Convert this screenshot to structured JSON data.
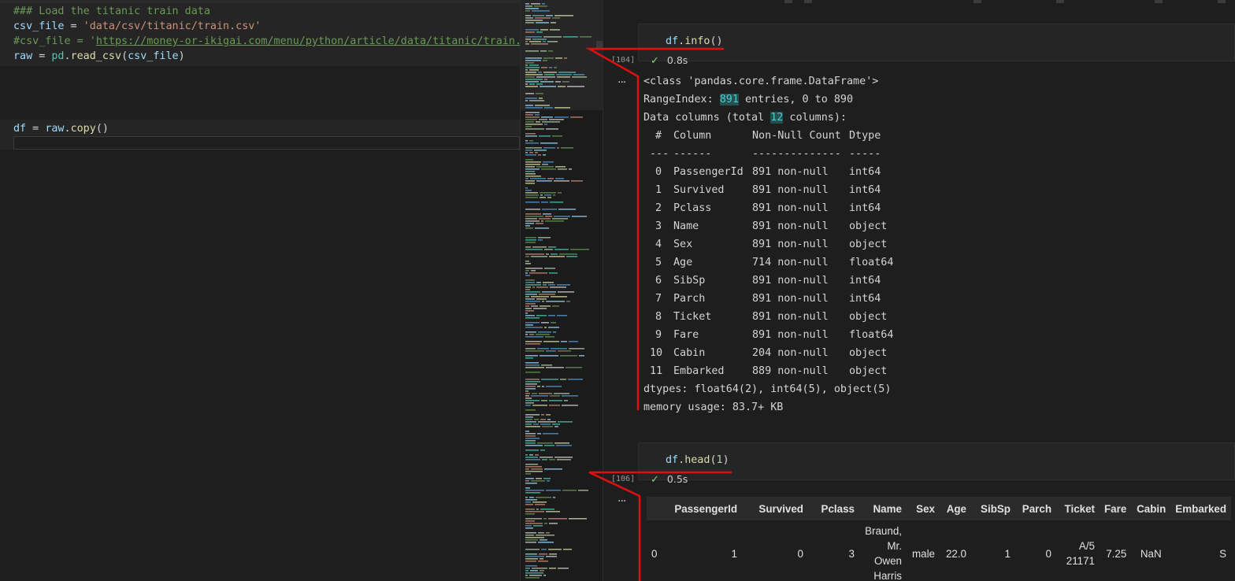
{
  "editor": {
    "block1": {
      "line1": "### Load the titanic train data",
      "line2": {
        "var": "csv_file",
        "op": " = ",
        "str": "'data/csv/titanic/train.csv'"
      },
      "line3": {
        "comment_prefix": "#csv_file = '",
        "url": "https://money-or-ikigai.com/menu/python/article/data/titanic/train.csv"
      },
      "line4": {
        "var": "raw",
        "op": " = ",
        "mod": "pd",
        "fn": "read_csv",
        "arg": "csv_file"
      }
    },
    "block2": {
      "line1": {
        "var": "df",
        "op": " = ",
        "obj": "raw",
        "fn": "copy"
      }
    }
  },
  "cells": [
    {
      "code": {
        "obj": "df",
        "fn": "info",
        "args": ""
      },
      "exec_count": "[104]",
      "status": "0.8s",
      "output": {
        "class_line": "<class 'pandas.core.frame.DataFrame'>",
        "range_prefix": "RangeIndex: ",
        "range_num": "891",
        "range_suffix": " entries, 0 to 890",
        "cols_prefix": "Data columns (total ",
        "cols_num": "12",
        "cols_suffix": " columns):",
        "header": [
          "#",
          "Column",
          "Non-Null Count",
          "Dtype"
        ],
        "sep": [
          "---",
          "------",
          "--------------",
          "-----"
        ],
        "rows": [
          [
            "0",
            "PassengerId",
            "891 non-null",
            "int64"
          ],
          [
            "1",
            "Survived",
            "891 non-null",
            "int64"
          ],
          [
            "2",
            "Pclass",
            "891 non-null",
            "int64"
          ],
          [
            "3",
            "Name",
            "891 non-null",
            "object"
          ],
          [
            "4",
            "Sex",
            "891 non-null",
            "object"
          ],
          [
            "5",
            "Age",
            "714 non-null",
            "float64"
          ],
          [
            "6",
            "SibSp",
            "891 non-null",
            "int64"
          ],
          [
            "7",
            "Parch",
            "891 non-null",
            "int64"
          ],
          [
            "8",
            "Ticket",
            "891 non-null",
            "object"
          ],
          [
            "9",
            "Fare",
            "891 non-null",
            "float64"
          ],
          [
            "10",
            "Cabin",
            "204 non-null",
            "object"
          ],
          [
            "11",
            "Embarked",
            "889 non-null",
            "object"
          ]
        ],
        "dtypes": "dtypes: float64(2), int64(5), object(5)",
        "memory": "memory usage: 83.7+ KB"
      }
    },
    {
      "code": {
        "obj": "df",
        "fn": "head",
        "args": "1"
      },
      "exec_count": "[106]",
      "status": "0.5s",
      "table": {
        "columns": [
          "",
          "PassengerId",
          "Survived",
          "Pclass",
          "Name",
          "Sex",
          "Age",
          "SibSp",
          "Parch",
          "Ticket",
          "Fare",
          "Cabin",
          "Embarked"
        ],
        "row": {
          "index": "0",
          "PassengerId": "1",
          "Survived": "0",
          "Pclass": "3",
          "Name_lines": [
            "Braund,",
            "Mr.",
            "Owen",
            "Harris"
          ],
          "Sex": "male",
          "Age": "22.0",
          "SibSp": "1",
          "Parch": "0",
          "Ticket_lines": [
            "A/5",
            "21171"
          ],
          "Fare": "7.25",
          "Cabin": "NaN",
          "Embarked": "S"
        }
      }
    }
  ],
  "ellipsis": "...",
  "check_icon": "check-icon",
  "colors": {
    "annotation": "#e01010",
    "highlight": "#4ec9d0"
  }
}
